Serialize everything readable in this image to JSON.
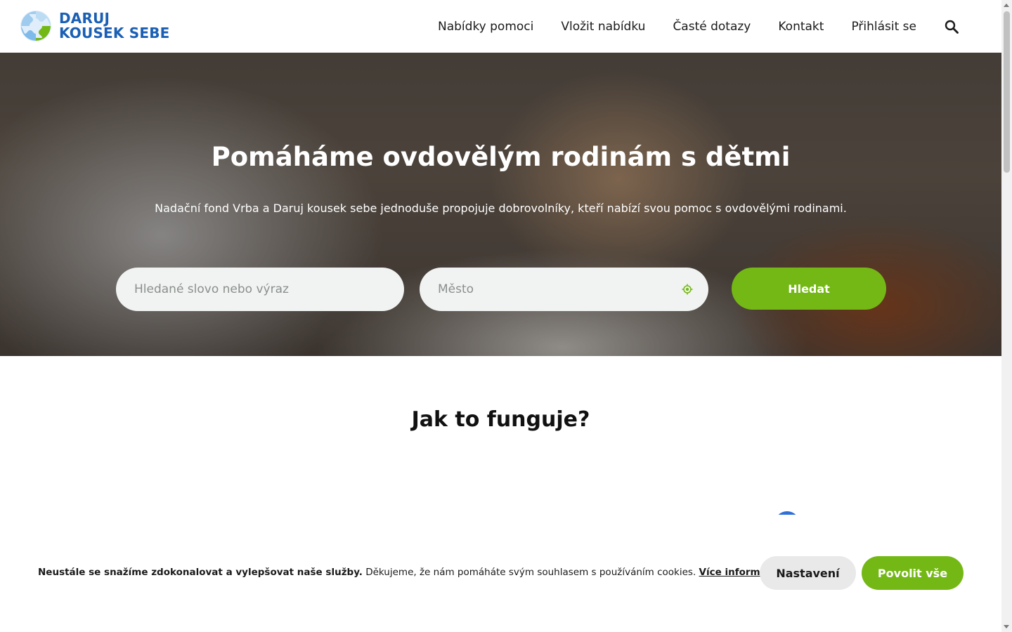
{
  "header": {
    "logo_line1": "DARUJ",
    "logo_line2": "KOUSEK SEBE",
    "logo_icon": "puzzle-logo-icon",
    "nav": [
      {
        "label": "Nabídky pomoci"
      },
      {
        "label": "Vložit nabídku"
      },
      {
        "label": "Časté dotazy"
      },
      {
        "label": "Kontakt"
      },
      {
        "label": "Přihlásit se"
      }
    ],
    "search_icon": "search-icon"
  },
  "hero": {
    "title": "Pomáháme ovdovělým rodinám s dětmi",
    "subtitle": "Nadační fond Vrba a Daruj kousek sebe jednoduše propojuje dobrovolníky, kteří nabízí svou pomoc s ovdovělými rodinami.",
    "query_placeholder": "Hledané slovo nebo výraz",
    "city_placeholder": "Město",
    "locate_icon": "location-target-icon",
    "search_button": "Hledat"
  },
  "section": {
    "title": "Jak to funguje?"
  },
  "cookie": {
    "bold_text": "Neustále se snažíme zdokonalovat a vylepšovat naše služby.",
    "text": " Děkujeme, že nám pomáháte svým souhlasem s používáním cookies. ",
    "link": "Více informací",
    "settings_button": "Nastavení",
    "allow_button": "Povolit vše"
  },
  "colors": {
    "brand_blue": "#1a5fb4",
    "accent_green": "#74b816",
    "field_bg": "#f1f3f2"
  }
}
